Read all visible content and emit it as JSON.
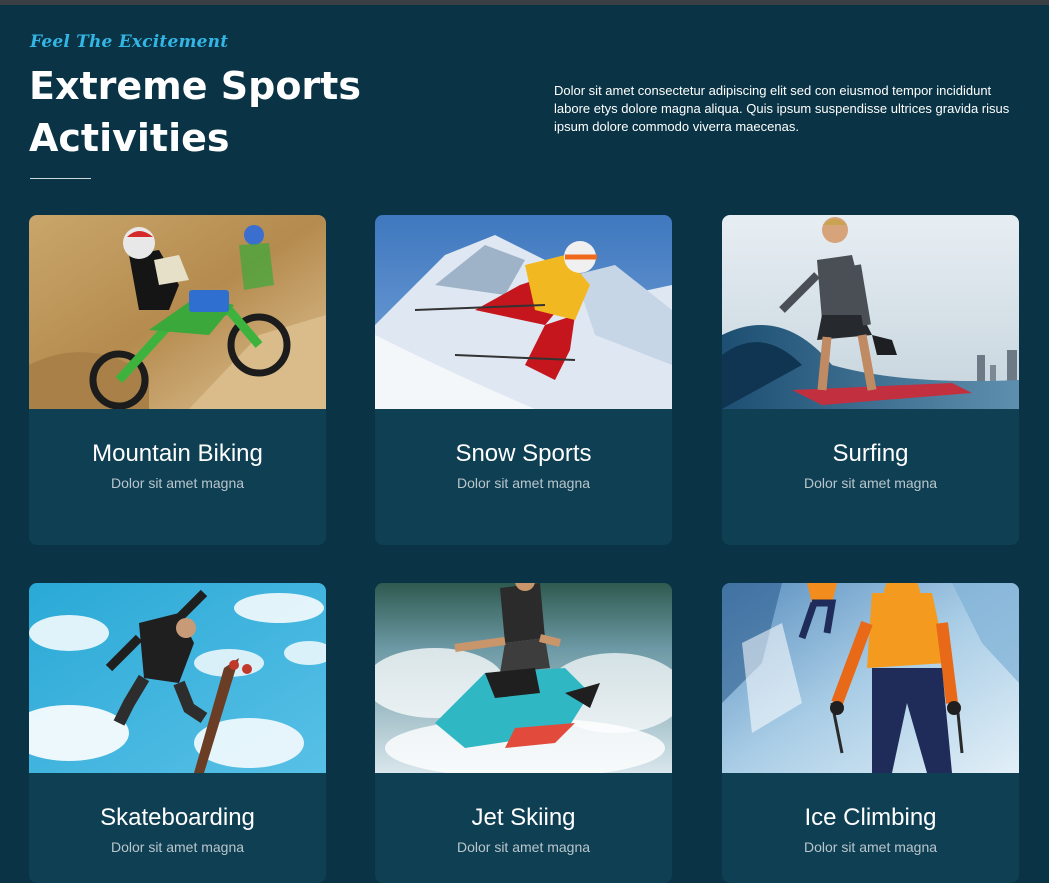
{
  "header": {
    "tagline": "Feel The Excitement",
    "title": "Extreme Sports Activities",
    "intro": "Dolor sit amet consectetur adipiscing elit sed con eiusmod tempor incididunt labore etys dolore magna aliqua. Quis ipsum suspendisse ultrices gravida risus ipsum dolore commodo viverra maecenas."
  },
  "activities": [
    {
      "name": "Mountain Biking",
      "desc": "Dolor sit amet magna",
      "photo": "motocross-rider-photo"
    },
    {
      "name": "Snow Sports",
      "desc": "Dolor sit amet magna",
      "photo": "skier-photo"
    },
    {
      "name": "Surfing",
      "desc": "Dolor sit amet magna",
      "photo": "surfer-photo"
    },
    {
      "name": "Skateboarding",
      "desc": "Dolor sit amet magna",
      "photo": "skateboarder-photo"
    },
    {
      "name": "Jet Skiing",
      "desc": "Dolor sit amet magna",
      "photo": "jet-ski-photo"
    },
    {
      "name": "Ice Climbing",
      "desc": "Dolor sit amet magna",
      "photo": "ice-climber-photo"
    }
  ],
  "colors": {
    "background": "#0a3445",
    "card": "#0f3f53",
    "accent": "#33b5e5"
  }
}
